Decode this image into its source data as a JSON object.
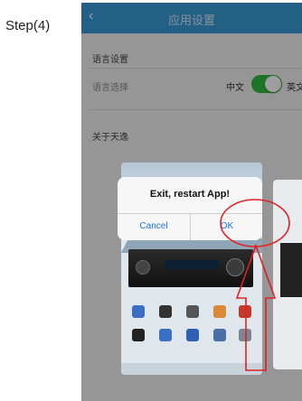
{
  "step_label": "Step(4)",
  "navbar": {
    "title": "应用设置",
    "back_icon": "chevron-left-icon"
  },
  "settings": {
    "language_section": "语言设置",
    "language_select_label": "语言选择",
    "chinese_label": "中文",
    "english_label": "英文",
    "toggle_on": true,
    "toggle_color": "#2fbb3e",
    "about_label": "关于天逸"
  },
  "dialog": {
    "message": "Exit, restart App!",
    "cancel_label": "Cancel",
    "ok_label": "OK",
    "button_color": "#1a73e8"
  },
  "colors": {
    "navbar": "#3a9bd8",
    "annotation": "#e02020"
  }
}
